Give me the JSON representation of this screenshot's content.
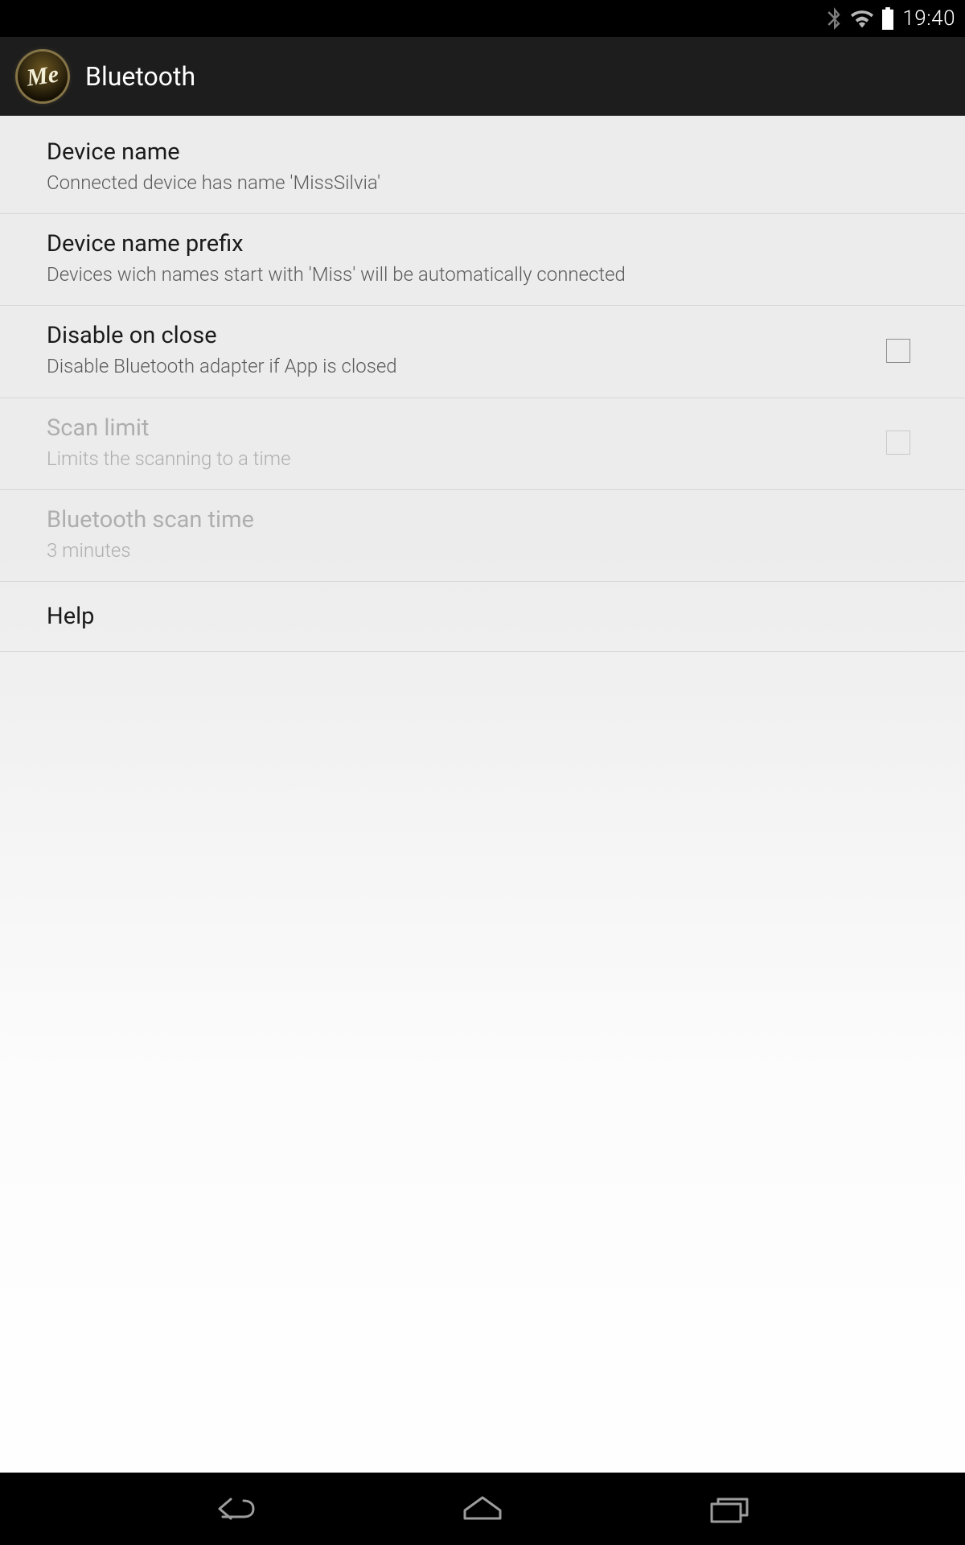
{
  "status": {
    "time": "19:40"
  },
  "header": {
    "title": "Bluetooth"
  },
  "settings": [
    {
      "title": "Device name",
      "subtitle": "Connected device has name 'MissSilvia'",
      "has_checkbox": false,
      "disabled": false
    },
    {
      "title": "Device name prefix",
      "subtitle": "Devices wich names start with 'Miss' will be automatically connected",
      "has_checkbox": false,
      "disabled": false
    },
    {
      "title": "Disable on close",
      "subtitle": "Disable Bluetooth adapter if App is closed",
      "has_checkbox": true,
      "checked": false,
      "disabled": false
    },
    {
      "title": "Scan limit",
      "subtitle": "Limits the scanning to a time",
      "has_checkbox": true,
      "checked": false,
      "disabled": true
    },
    {
      "title": "Bluetooth scan time",
      "subtitle": "3 minutes",
      "has_checkbox": false,
      "disabled": true
    },
    {
      "title": "Help",
      "subtitle": "",
      "has_checkbox": false,
      "disabled": false
    }
  ]
}
